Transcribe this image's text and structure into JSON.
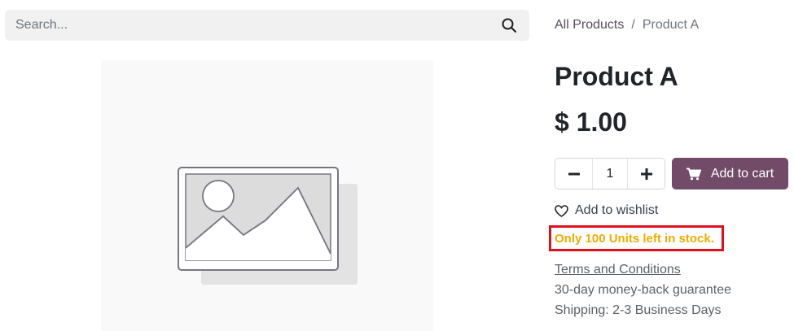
{
  "search": {
    "placeholder": "Search..."
  },
  "breadcrumb": {
    "parent": "All Products",
    "separator": "/",
    "current": "Product A"
  },
  "product": {
    "name": "Product A",
    "price": "$ 1.00"
  },
  "quantity": {
    "value": "1"
  },
  "cart": {
    "label": "Add to cart",
    "accent": "#714b67"
  },
  "wishlist": {
    "label": "Add to wishlist"
  },
  "stock": {
    "message": "Only 100 Units left in stock.",
    "color": "#f0ad00",
    "highlight": "#e0101c"
  },
  "info": {
    "terms": "Terms and Conditions",
    "guarantee": "30-day money-back guarantee",
    "shipping": "Shipping: 2-3 Business Days"
  },
  "icons": [
    "search-icon",
    "image-placeholder-icon",
    "minus-icon",
    "plus-icon",
    "cart-icon",
    "heart-icon"
  ]
}
